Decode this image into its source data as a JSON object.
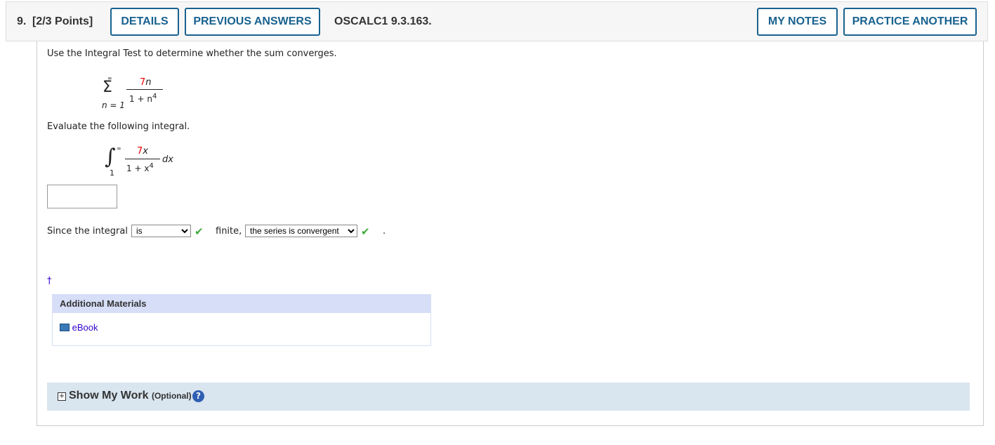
{
  "header": {
    "number": "9.",
    "points": "[2/3 Points]",
    "details": "DETAILS",
    "previous_answers": "PREVIOUS ANSWERS",
    "problem_id": "OSCALC1 9.3.163.",
    "my_notes": "MY NOTES",
    "practice_another": "PRACTICE ANOTHER"
  },
  "question": {
    "prompt": "Use the Integral Test to determine whether the sum converges.",
    "sum": {
      "upper": "∞",
      "lower": "n = 1",
      "num_coef": "7",
      "num_var": "n",
      "den": "1 + n",
      "den_exp": "4"
    },
    "evaluate_prompt": "Evaluate the following integral.",
    "integral": {
      "upper": "∞",
      "lower": "1",
      "num_coef": "7",
      "num_var": "x",
      "den": "1 + x",
      "den_exp": "4",
      "dx": "dx"
    },
    "answer_value": "",
    "since_text": "Since the integral",
    "select1_value": "is",
    "finite_text": "finite,",
    "select2_value": "the series is convergent",
    "period": ".",
    "dagger": "†"
  },
  "additional_materials": {
    "title": "Additional Materials",
    "ebook": "eBook"
  },
  "show_my_work": {
    "label": "Show My Work",
    "optional": "(Optional)",
    "help": "?"
  },
  "colors": {
    "accent": "#19628f",
    "highlight": "#e00000",
    "check": "#3cab3c",
    "materials_header": "#d7def7",
    "showwork_bg": "#d9e5ef"
  }
}
